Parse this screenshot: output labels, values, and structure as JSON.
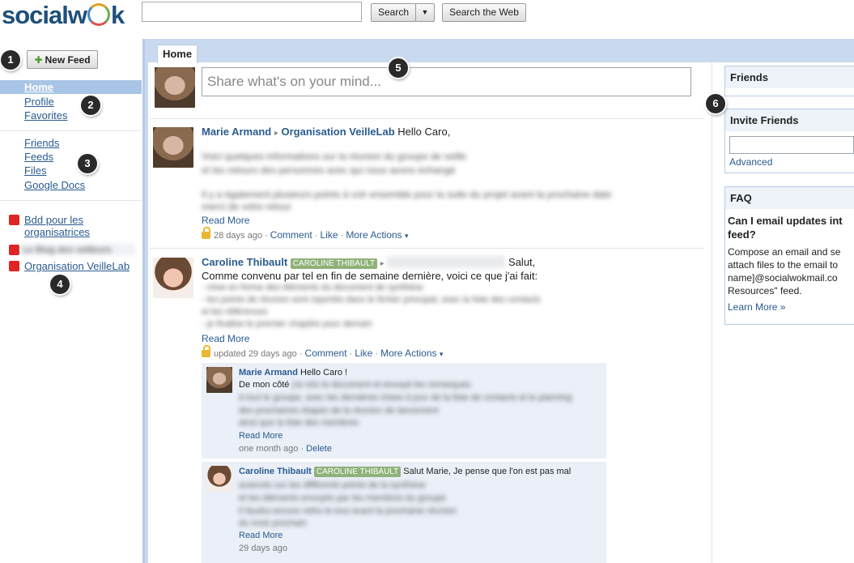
{
  "app": {
    "logo_text": "socialwok",
    "logo_left": "socialw",
    "logo_right": "k"
  },
  "topbar": {
    "search_placeholder": "",
    "search_label": "Search",
    "search_dropdown": "▼",
    "search_web_label": "Search the Web"
  },
  "callouts": [
    "1",
    "2",
    "3",
    "4",
    "5",
    "6"
  ],
  "sidebar": {
    "new_feed_label": "New Feed",
    "nav": [
      "Home",
      "Profile",
      "Favorites"
    ],
    "nav2": [
      "Friends",
      "Feeds",
      "Files",
      "Google Docs"
    ],
    "feeds": [
      {
        "label_line1": "Bdd pour les",
        "label_line2": "organisatrices"
      },
      {
        "label_line1": "Le Blog des veilleurs"
      },
      {
        "label_line1": "Organisation VeilleLab"
      }
    ]
  },
  "main": {
    "tab_label": "Home",
    "share_placeholder": "Share what's on your mind...",
    "posts": [
      {
        "author": "Marie Armand",
        "arrow": "▸",
        "target": "Organisation VeilleLab",
        "greeting": "Hello Caro,",
        "blurred_1": "Voici quelques informations sur la réunion du groupe de veille",
        "blurred_2": "et les retours des personnes avec qui nous avons échangé",
        "blurred_3": "Il y a également plusieurs points à voir ensemble pour la suite du projet avant la prochaine date",
        "blurred_4": "merci de votre retour",
        "read_more": "Read More",
        "time": "28 days ago",
        "comment": "Comment",
        "like": "Like",
        "more_actions": "More Actions",
        "caret": "▾"
      },
      {
        "author": "Caroline Thibault",
        "badge": "CAROLINE THIBAULT",
        "arrow": "▸",
        "target_blurred": "Organisation VeilleLab",
        "greeting": "Salut,",
        "text": "Comme convenu par tel en fin de semaine dernière, voici ce que j'ai fait:",
        "blurred_1": "- mise en forme des éléments du document de synthèse",
        "blurred_2": "- les points de réunion sont reportés dans le fichier principal, avec la liste des contacts",
        "blurred_3": "et les références",
        "blurred_4": "- je finalise le premier chapitre pour demain",
        "read_more": "Read More",
        "time": "updated 29 days ago",
        "comment": "Comment",
        "like": "Like",
        "more_actions": "More Actions",
        "caret": "▾"
      }
    ],
    "comments": [
      {
        "author": "Marie Armand",
        "text": "Hello Caro !",
        "line2_prefix": "De mon côté",
        "blurred_1": "j'ai relu le document et envoyé les remarques",
        "blurred_2": "à tout le groupe, avec les dernières mises à jour de la liste de contacts et le planning",
        "blurred_3": "des prochaines étapes de la réunion de lancement",
        "blurred_4": "ainsi que la liste des membres",
        "read_more": "Read More",
        "time": "one month ago",
        "delete": "Delete"
      },
      {
        "author": "Caroline Thibault",
        "badge": "CAROLINE THIBAULT",
        "text": "Salut Marie, Je pense que l'on est pas mal",
        "blurred_1": "avancés sur les différents points de la synthèse",
        "blurred_2": "et les éléments envoyés par les membres du groupe",
        "blurred_3": "il faudra encore relire le tout avant la prochaine réunion",
        "blurred_4": "du mois prochain",
        "read_more": "Read More",
        "time": "29 days ago"
      }
    ]
  },
  "right": {
    "friends_title": "Friends",
    "invite_title": "Invite Friends",
    "advanced": "Advanced",
    "faq_title": "FAQ",
    "faq_q": "Can I email updates int",
    "faq_q2": "feed?",
    "faq_a1": "Compose an email and se",
    "faq_a2": "attach files to the email to",
    "faq_a3": "name]@socialwokmail.co",
    "faq_a4": "Resources\" feed.",
    "learn_more": "Learn More »"
  },
  "colors": {
    "accent": "#2a5b8f",
    "nav_highlight": "#a8c4e6",
    "panel_bg": "#c9d9ef",
    "badge_bg": "#8fb279",
    "feed_square": "#e02424"
  }
}
